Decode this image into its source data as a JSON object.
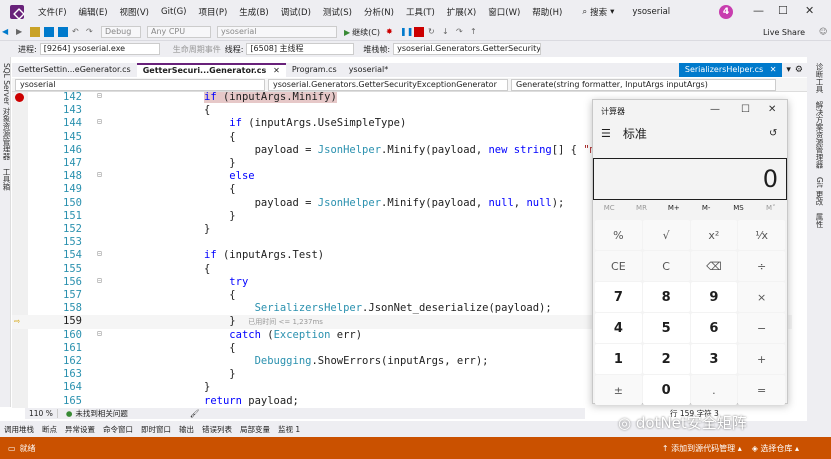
{
  "menubar": {
    "items": [
      "文件(F)",
      "编辑(E)",
      "视图(V)",
      "Git(G)",
      "项目(P)",
      "生成(B)",
      "调试(D)",
      "测试(S)",
      "分析(N)",
      "工具(T)",
      "扩展(X)",
      "窗口(W)",
      "帮助(H)"
    ],
    "search_label": "搜索",
    "title": "ysoserial",
    "badge": "4"
  },
  "toolbar": {
    "config": "Debug",
    "platform": "Any CPU",
    "project": "ysoserial",
    "continue_label": "继续(C)",
    "live_share": "Live Share"
  },
  "procbar": {
    "process_label": "进程:",
    "process": "[9264] ysoserial.exe",
    "lifecycle": "生命周期事件",
    "thread_label": "线程:",
    "thread": "[6508] 主线程",
    "stack_label": "堆栈帧:",
    "stack": "ysoserial.Generators.GetterSecurityExc"
  },
  "leftstrip": {
    "label1": "SQL Server 对象资源管理器",
    "label2": "工具箱"
  },
  "rightstrip": {
    "label1": "诊断工具",
    "label2": "解决方案资源管理器",
    "label3": "Git 更改",
    "label4": "属性"
  },
  "tabs": [
    {
      "label": "GetterSettin...eGenerator.cs",
      "active": false
    },
    {
      "label": "GetterSecuri...Generator.cs",
      "active": true
    },
    {
      "label": "Program.cs",
      "active": false
    },
    {
      "label": "ysoserial*",
      "active": false
    }
  ],
  "tab_right": "SerializersHelper.cs",
  "navbar": {
    "project": "ysoserial",
    "class": "ysoserial.Generators.GetterSecurityExceptionGenerator",
    "method": "Generate(string formatter, InputArgs inputArgs)"
  },
  "code_lines": [
    {
      "n": "142",
      "html": "<span class='hl'><span class='kw'>if</span> (inputArgs.Minify)</span>"
    },
    {
      "n": "143",
      "html": "{"
    },
    {
      "n": "144",
      "html": "    <span class='kw'>if</span> (inputArgs.UseSimpleType)"
    },
    {
      "n": "145",
      "html": "    {"
    },
    {
      "n": "146",
      "html": "        payload = <span class='ty'>JsonHelper</span>.Minify(payload, <span class='kw'>new</span> <span class='kw'>string</span>[] { <span class='st'>\"ms</span>"
    },
    {
      "n": "147",
      "html": "    }"
    },
    {
      "n": "148",
      "html": "    <span class='kw'>else</span>"
    },
    {
      "n": "149",
      "html": "    {"
    },
    {
      "n": "150",
      "html": "        payload = <span class='ty'>JsonHelper</span>.Minify(payload, <span class='kw'>null</span>, <span class='kw'>null</span>);"
    },
    {
      "n": "151",
      "html": "    }"
    },
    {
      "n": "152",
      "html": "}"
    },
    {
      "n": "153",
      "html": ""
    },
    {
      "n": "154",
      "html": "<span class='kw'>if</span> (inputArgs.Test)"
    },
    {
      "n": "155",
      "html": "{"
    },
    {
      "n": "156",
      "html": "    <span class='kw'>try</span>"
    },
    {
      "n": "157",
      "html": "    {"
    },
    {
      "n": "158",
      "html": "        <span class='ty'>SerializersHelper</span>.JsonNet_deserialize(payload);"
    },
    {
      "n": "159",
      "html": "    }  <span class='hint'>已用时间 &lt;= 1,237ms</span>"
    },
    {
      "n": "160",
      "html": "    <span class='kw'>catch</span> (<span class='ty'>Exception</span> err)"
    },
    {
      "n": "161",
      "html": "    {"
    },
    {
      "n": "162",
      "html": "        <span class='ty'>Debugging</span>.ShowErrors(inputArgs, err);"
    },
    {
      "n": "163",
      "html": "    }"
    },
    {
      "n": "164",
      "html": "}"
    },
    {
      "n": "165",
      "html": "<span class='kw'>return</span> payload;"
    }
  ],
  "edstatus": {
    "zoom": "110 %",
    "issues": "未找到相关问题"
  },
  "bottomtabs": [
    "调用堆栈",
    "断点",
    "异常设置",
    "命令窗口",
    "即时窗口",
    "输出",
    "错误列表",
    "局部变量",
    "监视 1"
  ],
  "statusbar": {
    "ready": "就绪",
    "add_source": "添加到源代码管理",
    "select_repo": "选择仓库"
  },
  "calculator": {
    "title": "计算器",
    "mode": "标准",
    "display": "0",
    "memory": [
      "MC",
      "MR",
      "M+",
      "M-",
      "MS",
      "M˅"
    ],
    "keys": [
      "%",
      "√",
      "x²",
      "¹⁄x",
      "CE",
      "C",
      "⌫",
      "÷",
      "7",
      "8",
      "9",
      "×",
      "4",
      "5",
      "6",
      "−",
      "1",
      "2",
      "3",
      "+",
      "±",
      "0",
      ".",
      "="
    ]
  },
  "behind_calc": "行 159   字符 3",
  "watermark": "dotNet安全矩阵"
}
